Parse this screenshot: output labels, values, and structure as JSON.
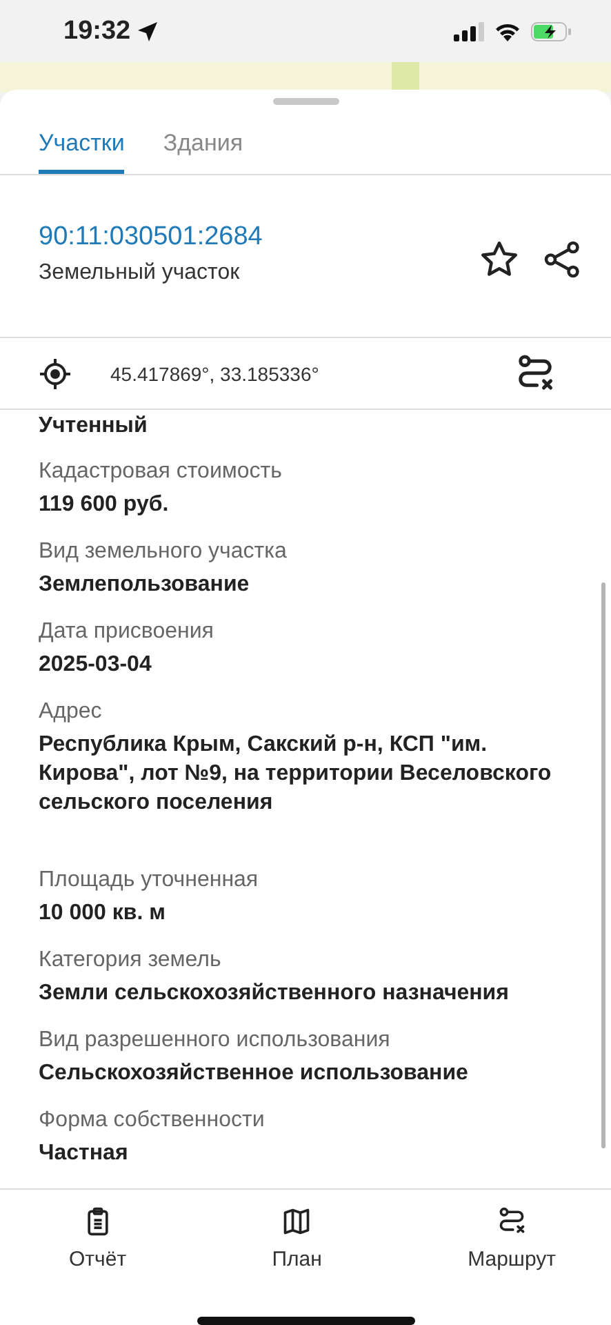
{
  "status_bar": {
    "time": "19:32"
  },
  "tabs": [
    {
      "label": "Участки",
      "selected": true
    },
    {
      "label": "Здания",
      "selected": false
    }
  ],
  "header": {
    "number": "90:11:030501:2684",
    "type": "Земельный участок"
  },
  "coordinates": "45.417869°, 33.185336°",
  "partial_value": "Учтенный",
  "fields": [
    {
      "label": "Кадастровая стоимость",
      "value": "119 600 руб."
    },
    {
      "label": "Вид земельного участка",
      "value": "Землепользование"
    },
    {
      "label": "Дата присвоения",
      "value": "2025-03-04"
    },
    {
      "label": "Адрес",
      "value": "Республика Крым, Сакский р-н, КСП \"им. Кирова\", лот №9, на территории Веселовского сельского поселения"
    },
    {
      "label": "Площадь уточненная",
      "value": "10 000 кв. м"
    },
    {
      "label": "Категория земель",
      "value": "Земли сельскохозяйственного назначения"
    },
    {
      "label": "Вид разрешенного использования",
      "value": "Сельскохозяйственное использование"
    },
    {
      "label": "Форма собственности",
      "value": "Частная"
    }
  ],
  "bottom_nav": [
    {
      "kind": "report",
      "label": "Отчёт"
    },
    {
      "kind": "plan",
      "label": "План"
    },
    {
      "kind": "route",
      "label": "Маршрут"
    }
  ]
}
